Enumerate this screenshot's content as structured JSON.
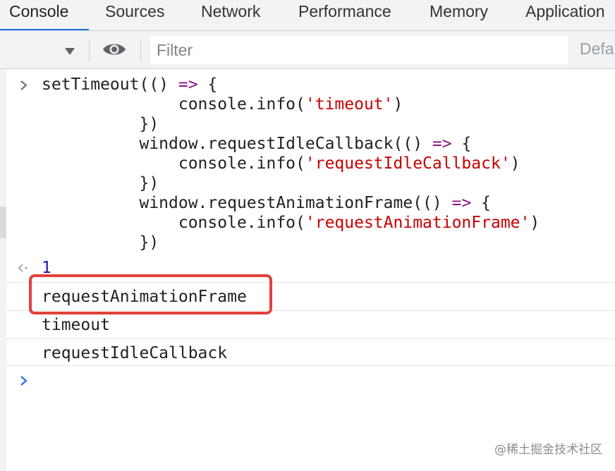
{
  "tabs": [
    {
      "label": "Console",
      "active": true
    },
    {
      "label": "Sources",
      "active": false
    },
    {
      "label": "Network",
      "active": false
    },
    {
      "label": "Performance",
      "active": false
    },
    {
      "label": "Memory",
      "active": false
    },
    {
      "label": "Application",
      "active": false
    }
  ],
  "toolbar": {
    "filter_placeholder": "Filter",
    "filter_value": "",
    "levels_label": "Defa",
    "dropdown_icon": "triangle-down-icon",
    "eye_icon": "eye-icon"
  },
  "console": {
    "input_lines": [
      "setTimeout(() => {",
      "              console.info('timeout')",
      "          })",
      "          window.requestIdleCallback(() => {",
      "              console.info('requestIdleCallback')",
      "          })",
      "          window.requestAnimationFrame(() => {",
      "              console.info('requestAnimationFrame')",
      "          })"
    ],
    "result_value": "1",
    "logs": [
      "requestAnimationFrame",
      "timeout",
      "requestIdleCallback"
    ],
    "highlighted_log_index": 0
  },
  "watermark": "@稀土掘金技术社区",
  "colors": {
    "accent": "#1a73e8",
    "string": "#c80000",
    "operator": "#881280",
    "result_number": "#1a1aa6",
    "highlight": "#e0413a",
    "toolbar_bg": "#f1f3f4"
  }
}
